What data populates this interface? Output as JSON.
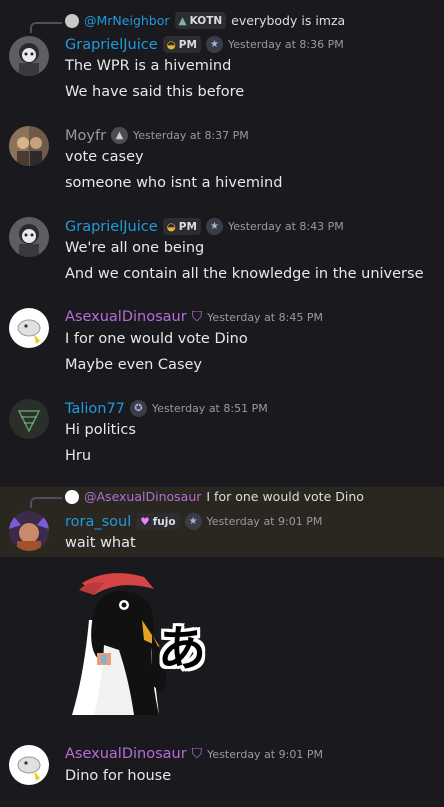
{
  "colors": {
    "blue_name": "#1f9bde",
    "gray_name": "#949ba4",
    "purple_name": "#b36ed8",
    "bg": "#1a1a1e"
  },
  "messages": [
    {
      "reply": {
        "author": "@MrNeighbor",
        "tag": "KOTN",
        "text": "everybody is imza"
      },
      "author": "GraprielJuice",
      "tag": "PM",
      "timestamp": "Yesterday at 8:36 PM",
      "lines": [
        "The WPR is a hivemind",
        "We have said this before"
      ]
    },
    {
      "author": "Moyfr",
      "timestamp": "Yesterday at 8:37 PM",
      "lines": [
        "vote casey",
        "someone who isnt a hivemind"
      ]
    },
    {
      "author": "GraprielJuice",
      "tag": "PM",
      "timestamp": "Yesterday at 8:43 PM",
      "lines": [
        "We're all one being",
        "And we contain all the knowledge in the universe"
      ]
    },
    {
      "author": "AsexualDinosaur",
      "timestamp": "Yesterday at 8:45 PM",
      "lines": [
        "I for one would vote Dino",
        "Maybe even Casey"
      ]
    },
    {
      "author": "Talion77",
      "timestamp": "Yesterday at 8:51 PM",
      "lines": [
        "Hi politics",
        "Hru"
      ]
    },
    {
      "reply": {
        "author": "@AsexualDinosaur",
        "text": "I for one would vote Dino"
      },
      "author": "rora_soul",
      "tag": "fujo",
      "timestamp": "Yesterday at 9:01 PM",
      "lines": [
        "wait what"
      ],
      "sticker_text": "あ"
    },
    {
      "author": "AsexualDinosaur",
      "timestamp": "Yesterday at 9:01 PM",
      "lines": [
        "Dino for house"
      ]
    }
  ]
}
